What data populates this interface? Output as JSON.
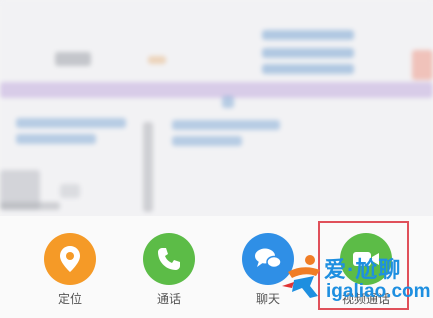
{
  "actions": [
    {
      "id": "location",
      "label": "定位",
      "icon": "location-pin-icon",
      "color": "#f59a27"
    },
    {
      "id": "call",
      "label": "通话",
      "icon": "phone-icon",
      "color": "#5cbc47"
    },
    {
      "id": "chat",
      "label": "聊天",
      "icon": "chat-bubbles-icon",
      "color": "#2f8fe6"
    },
    {
      "id": "video-call",
      "label": "视频通话",
      "icon": "video-camera-icon",
      "color": "#5cbc47",
      "highlighted": true
    }
  ],
  "highlight_color": "#e0505a",
  "watermark": {
    "line1": "爱·尬聊",
    "line2": "igaliao.com"
  }
}
